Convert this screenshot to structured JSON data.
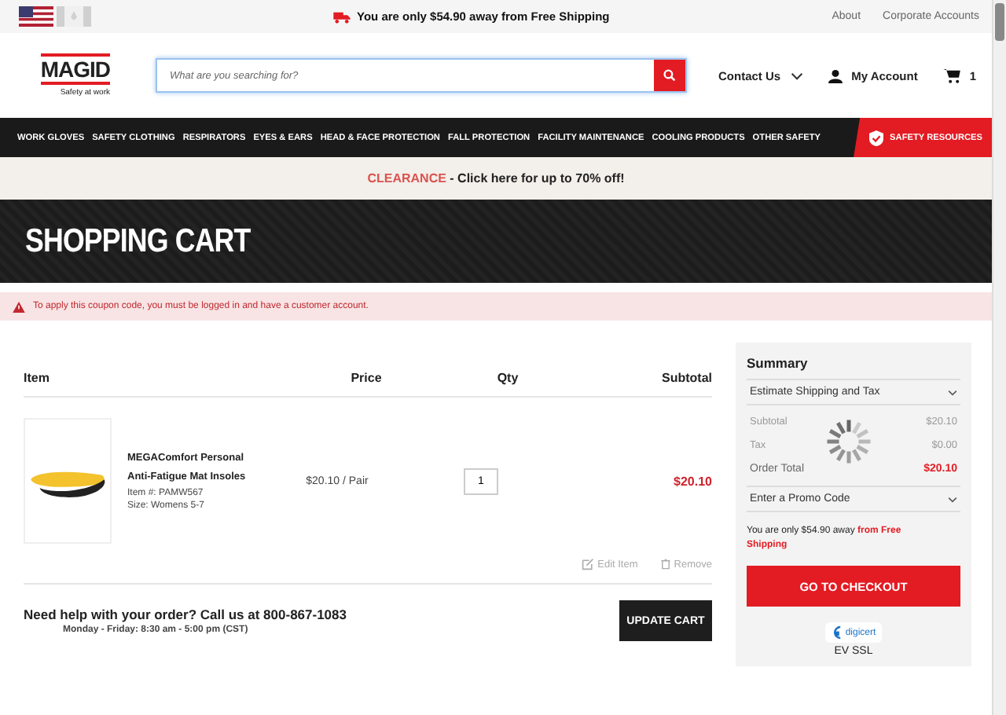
{
  "top_bar": {
    "flags": [
      {
        "selected": true
      },
      {
        "selected": false
      }
    ],
    "shipping_notice": "You are only $54.90 away from Free Shipping",
    "links": [
      "About",
      "Corporate Accounts"
    ]
  },
  "header": {
    "logo": "MAGID",
    "tagline": "Safety at work",
    "search": {
      "placeholder": "What are you searching for?"
    },
    "contact": "Contact Us",
    "account": "My Account",
    "cart_count": "1"
  },
  "nav": {
    "items": [
      "WORK GLOVES",
      "SAFETY CLOTHING",
      "RESPIRATORS",
      "EYES & EARS",
      "HEAD & FACE PROTECTION",
      "FALL PROTECTION",
      "FACILITY MAINTENANCE",
      "COOLING PRODUCTS",
      "OTHER SAFETY"
    ],
    "highlight": "SAFETY RESOURCES"
  },
  "promo": {
    "label": "CLEARANCE",
    "text": " - Click here for up to 70% off!"
  },
  "page_title": "SHOPPING CART",
  "alert": "To apply this coupon code, you must be logged in and have a customer account.",
  "cart": {
    "columns": [
      "Item",
      "Price",
      "Qty",
      "Subtotal"
    ],
    "rows": [
      {
        "name": "MEGAComfort Personal Anti-Fatigue Mat Insoles",
        "item_no": "Item #: PAMW567",
        "size": "Size: Womens 5-7",
        "price": "$20.10 / Pair",
        "qty": "1",
        "subtotal": "$20.10",
        "actions": [
          "Edit Item",
          "Remove"
        ]
      }
    ],
    "help": "Need help with your order? Call us at 800-867-1083",
    "hours": "Monday - Friday: 8:30 am - 5:00 pm (CST)",
    "update_button": "UPDATE CART"
  },
  "summary": {
    "title": "Summary",
    "estimate": "Estimate Shipping and Tax",
    "lines": [
      {
        "label": "Subtotal",
        "value": "$20.10",
        "kind": "plain"
      },
      {
        "label": "Tax",
        "value": "$0.00",
        "kind": "plain"
      },
      {
        "label": "Order Total",
        "value": "$20.10",
        "kind": "total"
      }
    ],
    "loading": true,
    "promo_code": "Enter a Promo Code",
    "notice": "You are only $54.90 away **from Free Shipping**",
    "checkout": "GO TO CHECKOUT",
    "badge": "digicert",
    "ssl": "EV SSL"
  }
}
